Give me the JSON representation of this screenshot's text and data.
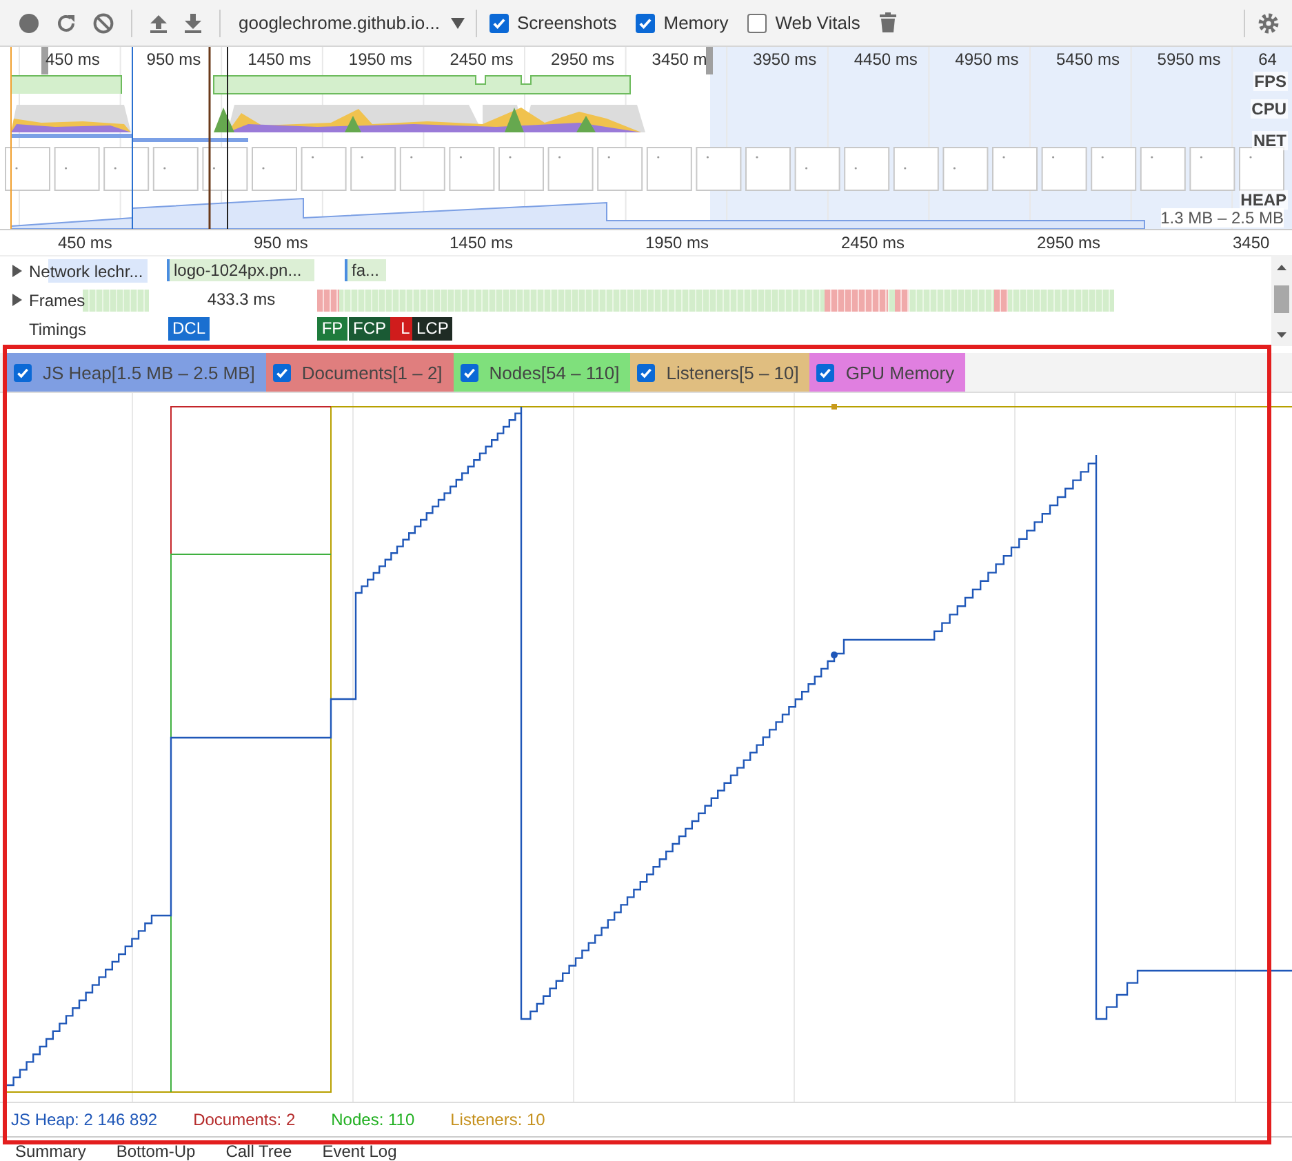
{
  "toolbar": {
    "url": "googlechrome.github.io...",
    "options": [
      {
        "label": "Screenshots",
        "checked": true
      },
      {
        "label": "Memory",
        "checked": true
      },
      {
        "label": "Web Vitals",
        "checked": false
      }
    ]
  },
  "overview": {
    "ticks": [
      "450 ms",
      "950 ms",
      "1450 ms",
      "1950 ms",
      "2450 ms",
      "2950 ms",
      "3450 m",
      "3950 ms",
      "4450 ms",
      "4950 ms",
      "5450 ms",
      "5950 ms",
      "64"
    ],
    "tracks": [
      "FPS",
      "CPU",
      "NET",
      "HEAP"
    ],
    "heap_range": "1.3 MB – 2.5 MB"
  },
  "flamechart": {
    "ticks": [
      "450 ms",
      "950 ms",
      "1450 ms",
      "1950 ms",
      "2450 ms",
      "2950 ms",
      "3450"
    ],
    "rows": [
      {
        "kind": "network",
        "label": "Network lechr...",
        "expanded": false,
        "items": [
          "logo-1024px.pn...",
          "fa..."
        ]
      },
      {
        "kind": "frames",
        "label": "Frames",
        "expanded": false,
        "items": [
          "433.3 ms"
        ]
      },
      {
        "kind": "timings",
        "label": "Timings",
        "markers": [
          {
            "label": "DCL",
            "color": "#1a6fd0"
          },
          {
            "label": "FP",
            "color": "#1e7b3c"
          },
          {
            "label": "FCP",
            "color": "#1a5a34"
          },
          {
            "label": "L",
            "color": "#d01c1c"
          },
          {
            "label": "LCP",
            "color": "#1f2b24"
          }
        ]
      }
    ]
  },
  "memory": {
    "counters": [
      {
        "label": "JS Heap[1.5 MB – 2.5 MB]",
        "checked": true,
        "color": "#7f9ee2"
      },
      {
        "label": "Documents[1 – 2]",
        "checked": true,
        "color": "#e07e7e"
      },
      {
        "label": "Nodes[54 – 110]",
        "checked": true,
        "color": "#7fe07c"
      },
      {
        "label": "Listeners[5 – 10]",
        "checked": true,
        "color": "#e0be80"
      },
      {
        "label": "GPU Memory",
        "checked": true,
        "color": "#e07fe0"
      }
    ],
    "readings": [
      {
        "text": "JS Heap: 2 146 892",
        "color": "#1f57b8"
      },
      {
        "text": "Documents: 2",
        "color": "#b52b2b"
      },
      {
        "text": "Nodes: 110",
        "color": "#22b022"
      },
      {
        "text": "Listeners: 10",
        "color": "#c5901c"
      }
    ]
  },
  "tabs": [
    "Summary",
    "Bottom-Up",
    "Call Tree",
    "Event Log"
  ]
}
